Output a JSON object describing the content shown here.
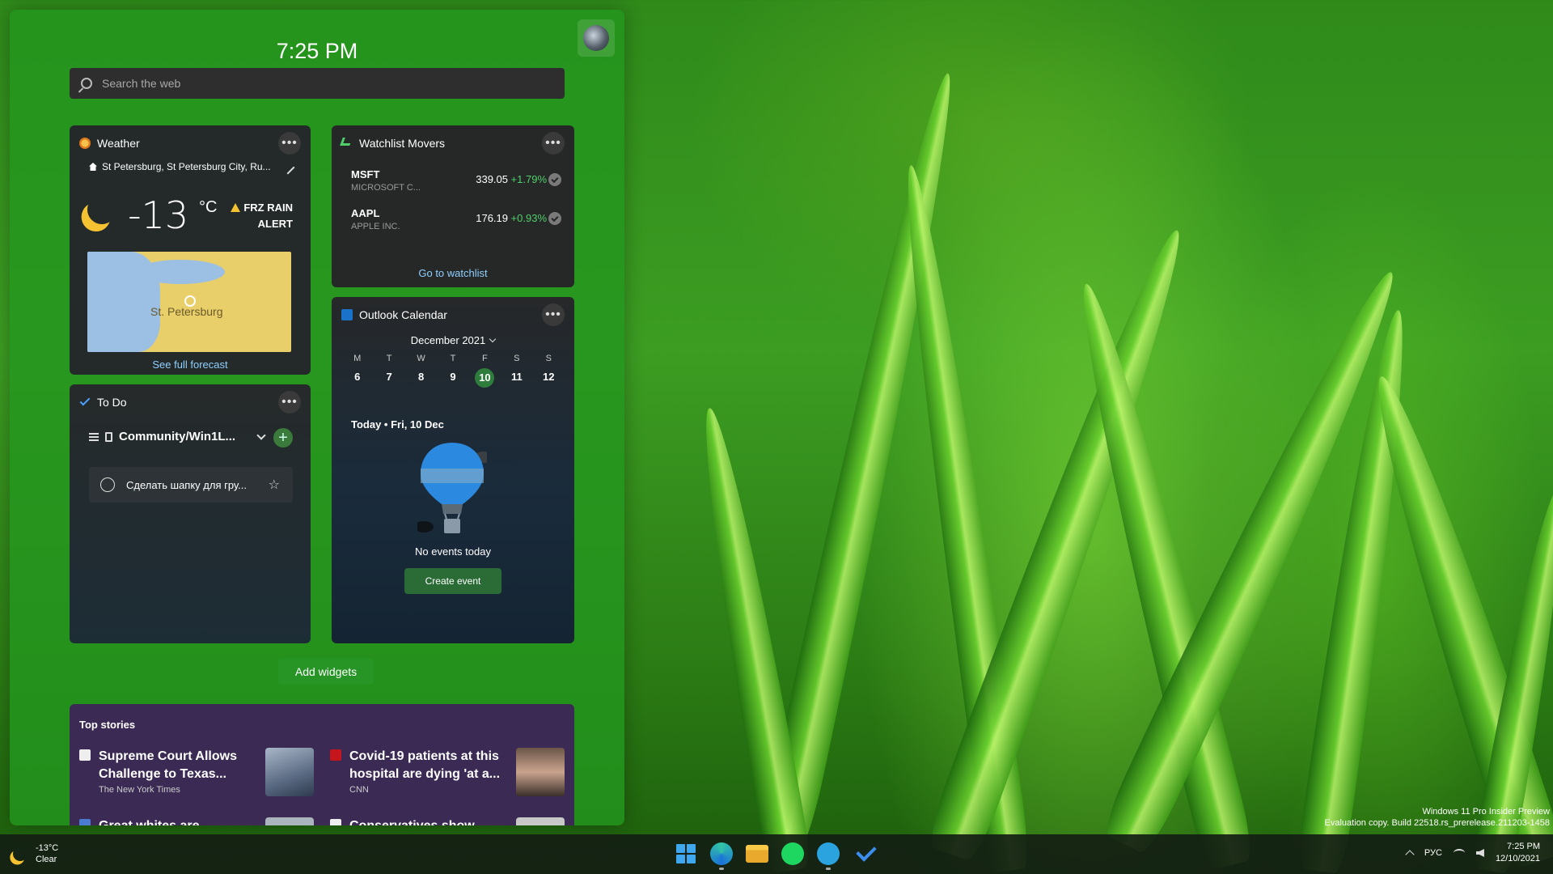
{
  "panel": {
    "time": "7:25 PM",
    "search_placeholder": "Search the web",
    "add_widgets": "Add widgets"
  },
  "weather": {
    "title": "Weather",
    "location": "St Petersburg, St Petersburg City, Ru...",
    "temperature": "-13",
    "unit": "°C",
    "alert_line1": "FRZ RAIN",
    "alert_line2": "ALERT",
    "map_label": "St. Petersburg",
    "forecast_link": "See full forecast"
  },
  "watchlist": {
    "title": "Watchlist Movers",
    "stocks": [
      {
        "ticker": "MSFT",
        "company": "MICROSOFT C...",
        "price": "339.05",
        "change": "+1.79%"
      },
      {
        "ticker": "AAPL",
        "company": "APPLE INC.",
        "price": "176.19",
        "change": "+0.93%"
      }
    ],
    "link": "Go to watchlist"
  },
  "todo": {
    "title": "To Do",
    "list_name": "Community/Win1L...",
    "task": "Сделать шапку для гру..."
  },
  "calendar": {
    "title": "Outlook Calendar",
    "month": "December 2021",
    "weekdays": [
      "M",
      "T",
      "W",
      "T",
      "F",
      "S",
      "S"
    ],
    "days": [
      "6",
      "7",
      "8",
      "9",
      "10",
      "11",
      "12"
    ],
    "today_index": 4,
    "today_label": "Today • Fri, 10 Dec",
    "no_events": "No events today",
    "create_event": "Create event"
  },
  "stories": {
    "title": "Top stories",
    "items": [
      {
        "headline": "Supreme Court Allows Challenge to Texas...",
        "source": "The New York Times"
      },
      {
        "headline": "Covid-19 patients at this hospital are dying 'at a...",
        "source": "CNN"
      },
      {
        "headline": "Great whites are",
        "source": ""
      },
      {
        "headline": "Conservatives show",
        "source": ""
      }
    ]
  },
  "watermark": {
    "line1": "Windows 11 Pro Insider Preview",
    "line2": "Evaluation copy. Build 22518.rs_prerelease.211203-1458"
  },
  "taskbar": {
    "weather_temp": "-13°C",
    "weather_cond": "Clear",
    "apps": [
      "start-icon",
      "edge-icon",
      "file-explorer-icon",
      "spotify-icon",
      "telegram-icon",
      "todo-app-icon"
    ],
    "language": "РУС",
    "time": "7:25 PM",
    "date": "12/10/2021"
  },
  "colors": {
    "accent_green": "#2f7d3d",
    "positive_change": "#4fd06a",
    "link_blue": "#8fd0ff"
  }
}
